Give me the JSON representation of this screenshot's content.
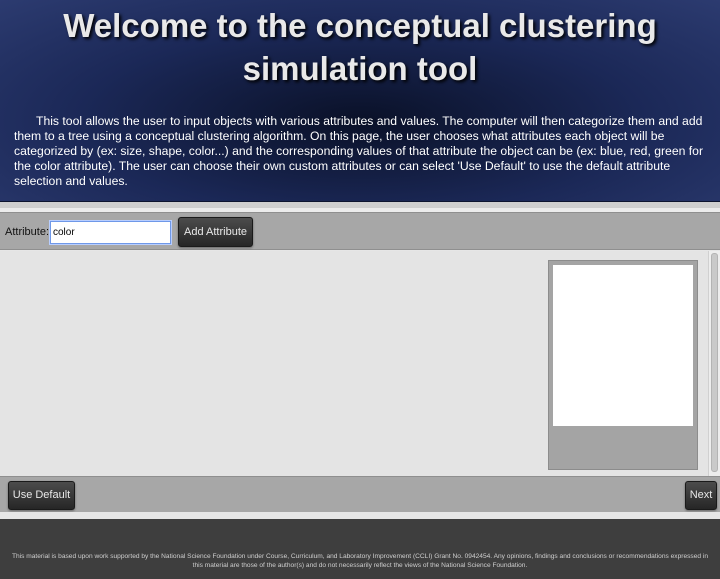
{
  "header": {
    "title": "Welcome to the conceptual clustering simulation tool",
    "intro": "This tool allows the user to input objects with various attributes and values. The computer will then categorize them and add them to a tree using a conceptual clustering algorithm. On this page, the user chooses what attributes each object will be categorized by (ex: size, shape, color...) and the corresponding values of that attribute the object can be (ex: blue, red, green for the color attribute). The user can choose their own custom attributes or can select 'Use Default' to use the default attribute selection and values."
  },
  "toolbar": {
    "attribute_label": "Attribute:",
    "attribute_value": "color",
    "add_attribute_label": "Add Attribute"
  },
  "bottombar": {
    "use_default_label": "Use Default",
    "next_label": "Next"
  },
  "footer": {
    "text": "This material is based upon work supported by the National Science Foundation under Course, Curriculum, and Laboratory Improvement (CCLI) Grant No. 0942454. Any opinions, findings and conclusions or recommendations expressed in this material are those of the author(s) and do not necessarily reflect the views of the National Science Foundation."
  },
  "colors": {
    "header_bg": "#1b2857",
    "button_bg": "#333333",
    "toolbar_bg": "#a7a7a7",
    "footer_bg": "#3e3e3e"
  }
}
